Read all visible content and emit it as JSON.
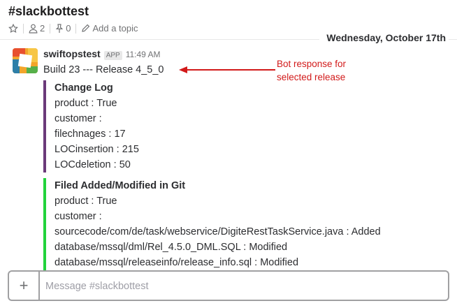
{
  "channel": {
    "name": "#slackbottest",
    "members_count": "2",
    "pins_count": "0",
    "topic_label": "Add a topic"
  },
  "day_divider": "Wednesday, October 17th",
  "message": {
    "username": "swiftopstest",
    "badge": "APP",
    "time": "11:49 AM",
    "text": "Build 23 --- Release 4_5_0",
    "attachments": [
      {
        "title": "Change Log",
        "color": "#6b3a7a",
        "lines": [
          "product : True",
          "customer :",
          "filechnages : 17",
          "LOCinsertion : 215",
          "LOCdeletion : 50"
        ]
      },
      {
        "title": "Filed Added/Modified in Git",
        "color": "#22d33c",
        "lines": [
          "product : True",
          "customer :",
          "sourcecode/com/de/task/webservice/DigiteRestTaskService.java : Added",
          "database/mssql/dml/Rel_4.5.0_DML.SQL : Modified",
          "database/mssql/releaseinfo/release_info.sql : Modified"
        ]
      }
    ]
  },
  "annotation": {
    "line1": "Bot response for",
    "line2": "selected release",
    "color": "#d21a1a"
  },
  "composer": {
    "placeholder": "Message #slackbottest"
  },
  "icons": [
    "star-icon",
    "person-icon",
    "pin-icon",
    "pencil-icon",
    "plus-icon"
  ]
}
